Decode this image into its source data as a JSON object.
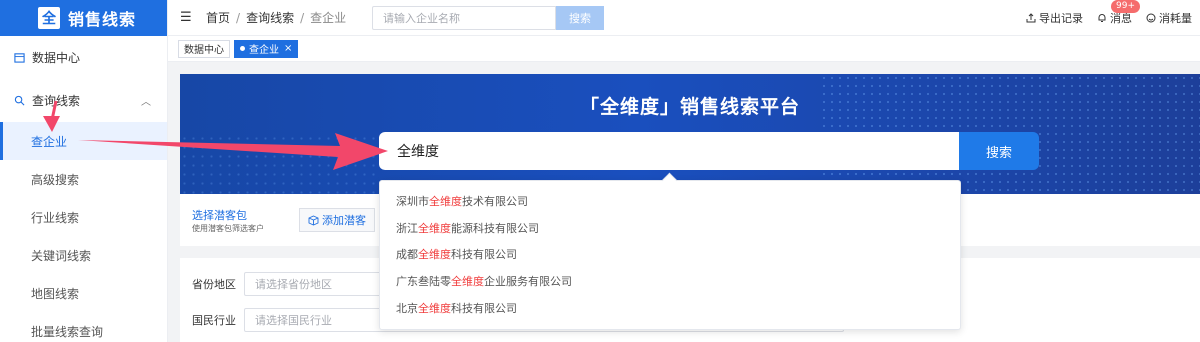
{
  "app": {
    "logo_text": "销售线索",
    "logo_mark": "全"
  },
  "sidebar": {
    "data_center": "数据中心",
    "group_label": "查询线索",
    "items": [
      {
        "label": "查企业",
        "active": true
      },
      {
        "label": "高级搜索"
      },
      {
        "label": "行业线索"
      },
      {
        "label": "关键词线索"
      },
      {
        "label": "地图线索"
      },
      {
        "label": "批量线索查询"
      }
    ]
  },
  "topbar": {
    "breadcrumb": [
      "首页",
      "查询线索",
      "查企业"
    ],
    "search_placeholder": "请输入企业名称",
    "search_button": "搜索",
    "export_label": "导出记录",
    "messages_label": "消息",
    "messages_badge": "99+",
    "consumption_label": "消耗量"
  },
  "tabs": [
    {
      "label": "数据中心",
      "active": false
    },
    {
      "label": "查企业",
      "active": true,
      "close": "×"
    }
  ],
  "banner": {
    "title": "「全维度」销售线索平台"
  },
  "main_search": {
    "value": "全维度",
    "button": "搜索",
    "suggestions": [
      {
        "pre": "深圳市",
        "hl": "全维度",
        "post": "技术有限公司"
      },
      {
        "pre": "浙江",
        "hl": "全维度",
        "post": "能源科技有限公司"
      },
      {
        "pre": "成都",
        "hl": "全维度",
        "post": "科技有限公司"
      },
      {
        "pre": "广东叁陆零",
        "hl": "全维度",
        "post": "企业服务有限公司"
      },
      {
        "pre": "北京",
        "hl": "全维度",
        "post": "科技有限公司"
      }
    ]
  },
  "packet": {
    "title": "选择潜客包",
    "subtitle": "使用潜客包筛选客户",
    "add_button": "添加潜客"
  },
  "filters": [
    {
      "label": "省份地区",
      "placeholder": "请选择省份地区"
    },
    {
      "label": "国民行业",
      "placeholder": "请选择国民行业"
    }
  ],
  "colors": {
    "primary": "#1f6fe0",
    "highlight": "#f03b3b",
    "annotation_arrow": "#f2476a"
  }
}
